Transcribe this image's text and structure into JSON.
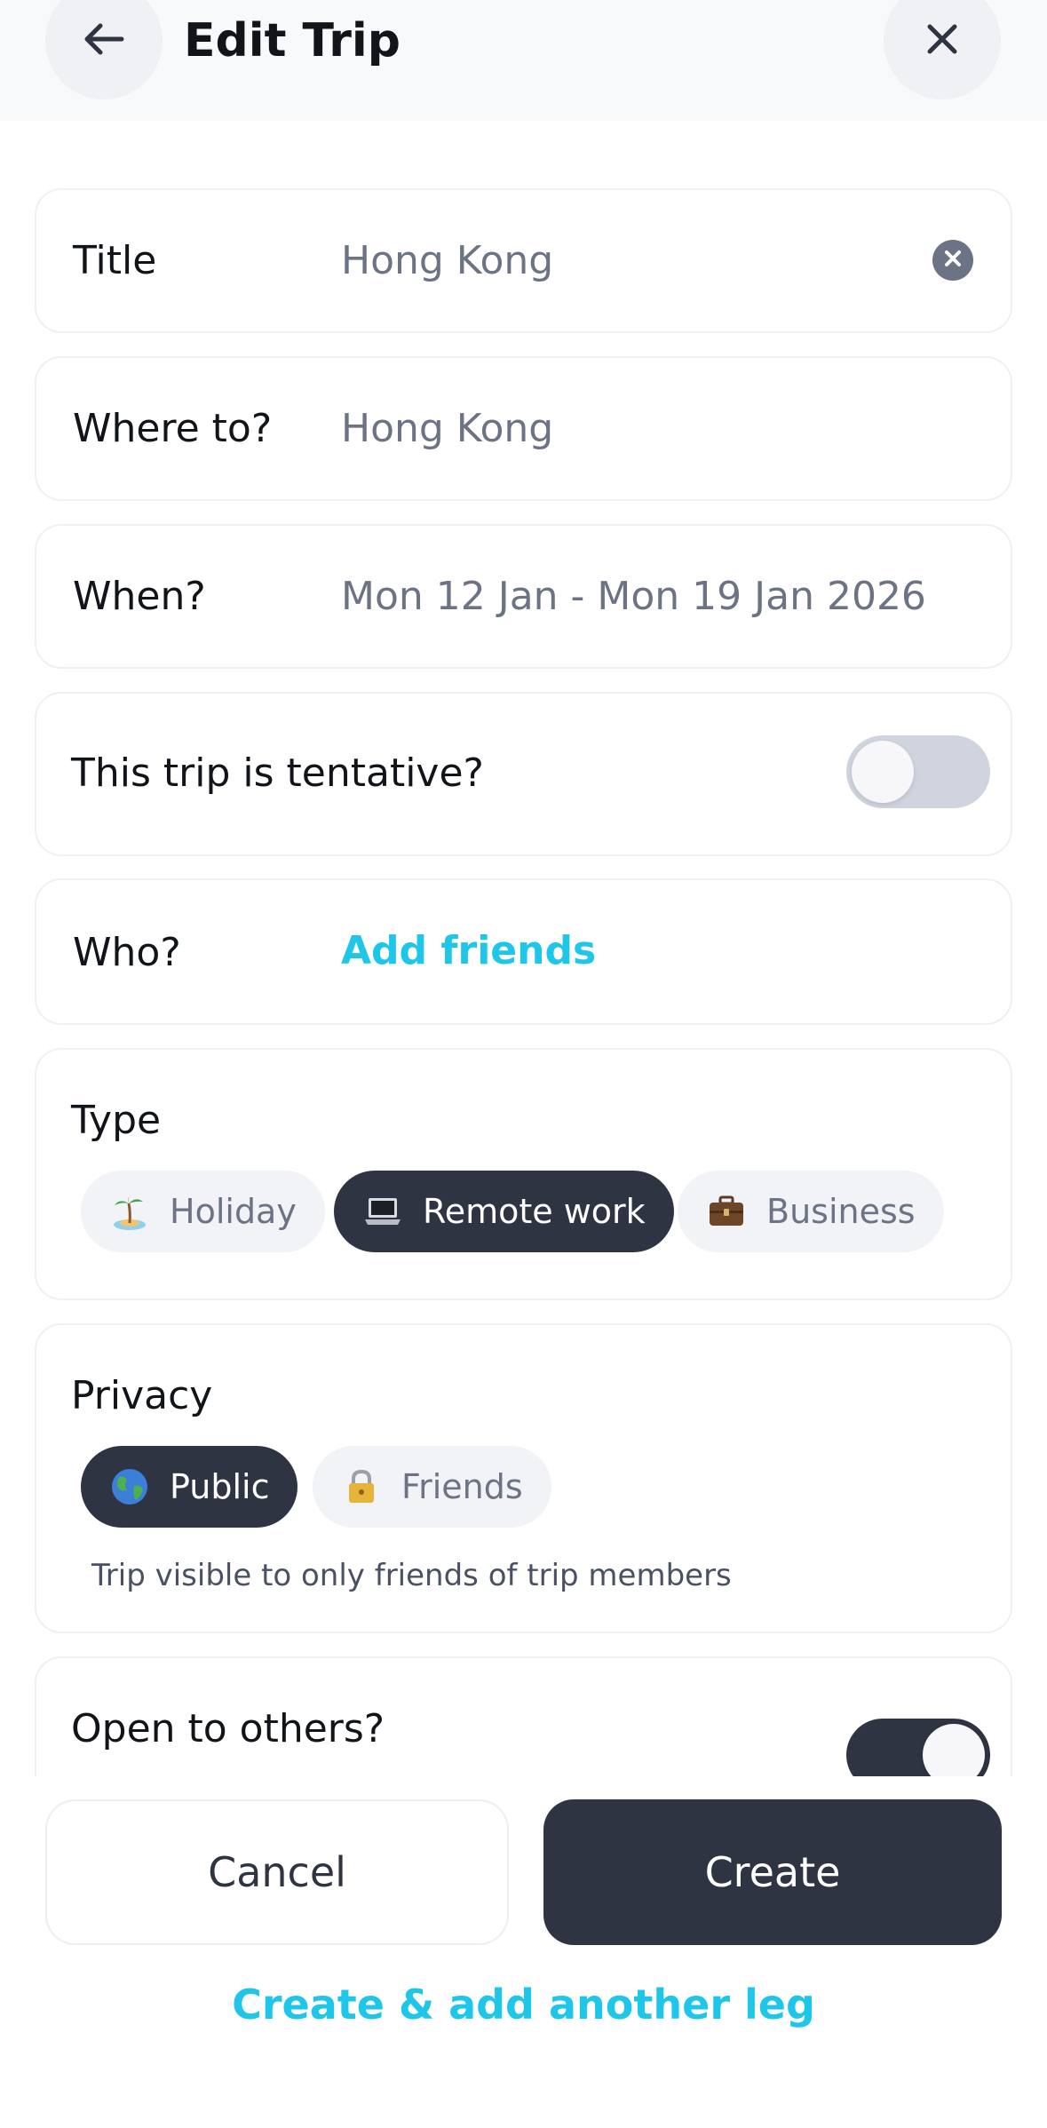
{
  "header": {
    "title": "Edit Trip",
    "back_icon": "arrow-left-icon",
    "close_icon": "close-icon"
  },
  "form": {
    "title": {
      "label": "Title",
      "value": "Hong Kong"
    },
    "destination": {
      "label": "Where to?",
      "value": "Hong Kong"
    },
    "dates": {
      "label": "When?",
      "value": "Mon 12 Jan - Mon 19 Jan 2026"
    },
    "tentative": {
      "label": "This trip is tentative?",
      "enabled": false
    },
    "who": {
      "label": "Who?",
      "link": "Add friends"
    },
    "type": {
      "label": "Type",
      "options": [
        {
          "label": "Holiday",
          "icon": "palm-island-icon",
          "selected": false
        },
        {
          "label": "Remote work",
          "icon": "laptop-icon",
          "selected": true
        },
        {
          "label": "Business",
          "icon": "briefcase-icon",
          "selected": false
        }
      ]
    },
    "privacy": {
      "label": "Privacy",
      "options": [
        {
          "label": "Public",
          "icon": "globe-icon",
          "selected": true
        },
        {
          "label": "Friends",
          "icon": "lock-icon",
          "selected": false
        }
      ],
      "helper": "Trip visible to only friends of trip members"
    },
    "open_to_others": {
      "label": "Open to others?",
      "enabled": true
    }
  },
  "actions": {
    "cancel": "Cancel",
    "create": "Create",
    "create_add_leg": "Create & add another leg"
  },
  "colors": {
    "accent": "#1ec6ea",
    "dark": "#2f3443",
    "muted_text": "#6b7385"
  }
}
